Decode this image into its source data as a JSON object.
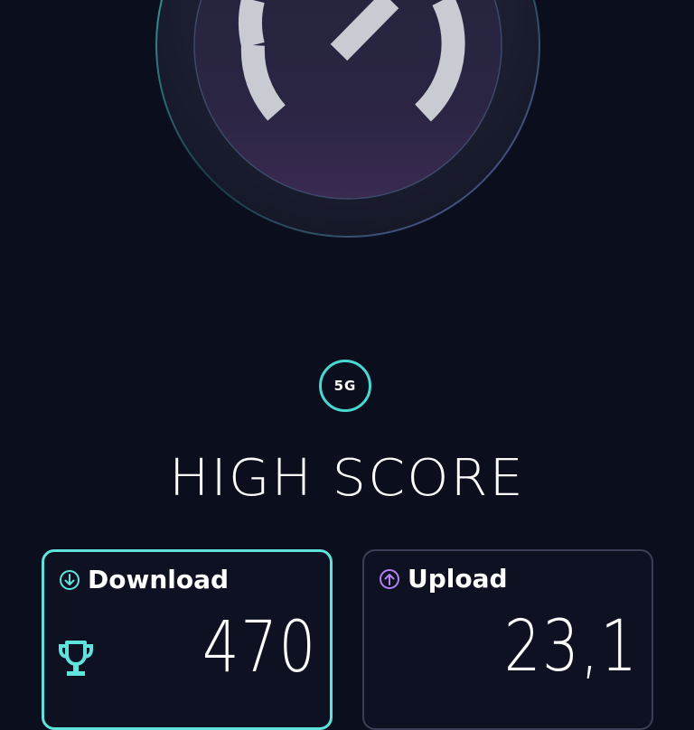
{
  "gauge": {
    "needle_icon": "speedometer-needle",
    "accent_color": "#49d7d2"
  },
  "network": {
    "badge_label": "5G",
    "color": "#49d7d2"
  },
  "title": "HIGH SCORE",
  "cards": {
    "download": {
      "label": "Download",
      "value": "470",
      "icon": "arrow-down-circle-icon",
      "accent": "#5fe3dc"
    },
    "upload": {
      "label": "Upload",
      "value": "23,1",
      "icon": "arrow-up-circle-icon",
      "accent": "#b47ff0"
    }
  },
  "trophy_icon": "trophy-icon"
}
